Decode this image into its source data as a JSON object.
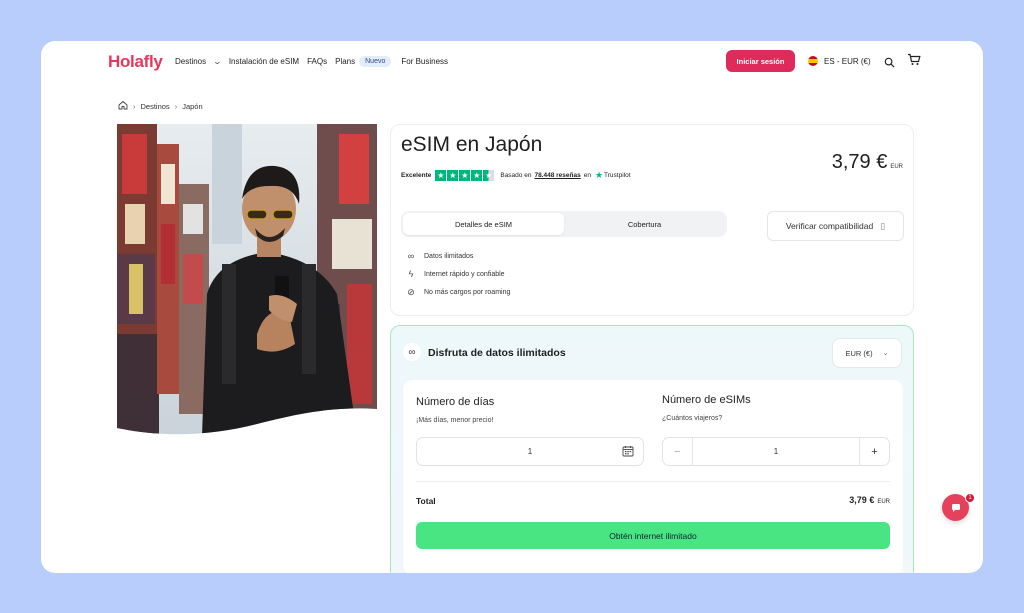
{
  "brand": {
    "logo": "Holafly",
    "accent": "#e8365d",
    "cta_green": "#48e582"
  },
  "nav": {
    "destinations": "Destinos",
    "install": "Instalación de eSIM",
    "faqs": "FAQs",
    "plans": "Plans",
    "new_badge": "Nuevo",
    "business": "For Business"
  },
  "header": {
    "login": "Iniciar sesión",
    "language": "ES - EUR (€)",
    "icons": [
      "search-icon",
      "cart-icon"
    ]
  },
  "breadcrumb": {
    "home_icon": "home-icon",
    "items": [
      "Destinos",
      "Japón"
    ]
  },
  "product": {
    "title": "eSIM en Japón",
    "rating_label": "Excelente",
    "stars": 4.5,
    "based_on": "Basado en",
    "reviews": "78.448 reseñas",
    "on": "en",
    "trustpilot": "Trustpilot",
    "price": "3,79 €",
    "price_currency": "EUR",
    "tabs": [
      "Detalles de eSIM",
      "Cobertura"
    ],
    "verify": "Verificar compatibilidad",
    "features": [
      "Datos ilimitados",
      "Internet rápido y confiable",
      "No más cargos por roaming"
    ]
  },
  "plan": {
    "title": "Disfruta de datos ilimitados",
    "currency_select": "EUR (€)",
    "days_label": "Número de días",
    "days_hint": "¡Más días, menor precio!",
    "days_value": "1",
    "esims_label": "Número de eSIMs",
    "esims_hint": "¿Cuántos viajeros?",
    "esims_value": "1",
    "minus": "−",
    "plus": "+",
    "total_label": "Total",
    "total_price": "3,79 €",
    "total_currency": "EUR",
    "cta": "Obtén internet ilimitado"
  },
  "chat": {
    "badge": "1"
  }
}
